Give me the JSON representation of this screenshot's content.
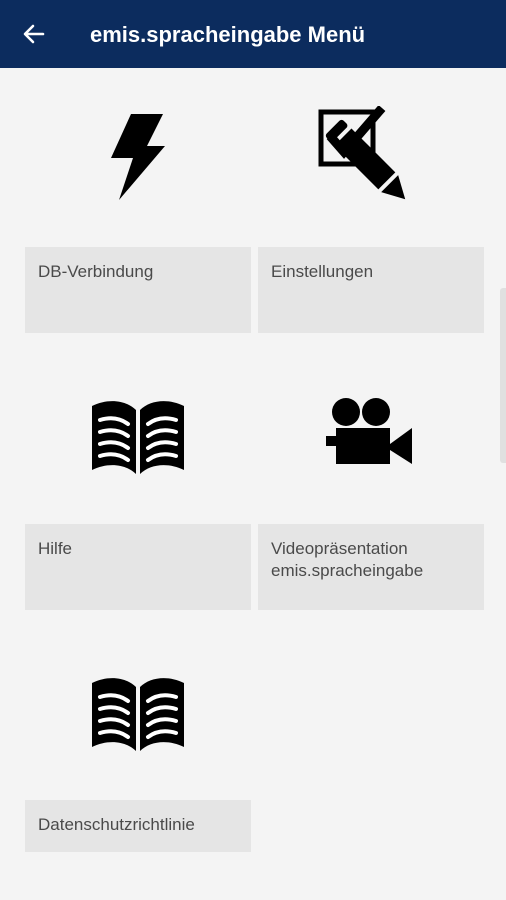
{
  "appbar": {
    "title": "emis.spracheingabe Menü",
    "back_icon": "arrow-left-icon",
    "background": "#0c2c5e"
  },
  "menu": {
    "items": [
      {
        "label": "DB-Verbindung",
        "icon": "lightning-bolt-icon"
      },
      {
        "label": "Einstellungen",
        "icon": "checkbox-pencil-icon"
      },
      {
        "label": "Hilfe",
        "icon": "open-book-icon"
      },
      {
        "label": "Videopräsentation\nemis.spracheingabe",
        "icon": "video-camera-icon"
      },
      {
        "label": "Datenschutzrichtlinie",
        "icon": "open-book-icon"
      }
    ],
    "tile_color": "#e5e5e5"
  }
}
